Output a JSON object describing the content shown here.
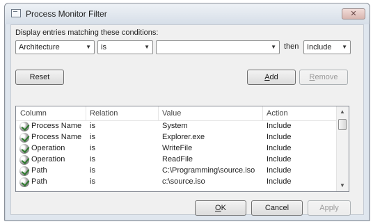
{
  "window": {
    "title": "Process Monitor Filter",
    "close_label": "✕"
  },
  "conditions": {
    "prompt": "Display entries matching these conditions:",
    "column_select": "Architecture",
    "relation_select": "is",
    "value_input": "",
    "then_label": "then",
    "action_select": "Include"
  },
  "buttons": {
    "reset": "Reset",
    "add": "Add",
    "remove": "Remove",
    "ok": "OK",
    "cancel": "Cancel",
    "apply": "Apply"
  },
  "list": {
    "headers": [
      "Column",
      "Relation",
      "Value",
      "Action"
    ],
    "rows": [
      {
        "column": "Process Name",
        "relation": "is",
        "value": "System",
        "action": "Include"
      },
      {
        "column": "Process Name",
        "relation": "is",
        "value": "Explorer.exe",
        "action": "Include"
      },
      {
        "column": "Operation",
        "relation": "is",
        "value": "WriteFile",
        "action": "Include"
      },
      {
        "column": "Operation",
        "relation": "is",
        "value": "ReadFile",
        "action": "Include"
      },
      {
        "column": "Path",
        "relation": "is",
        "value": "C:\\Programming\\source.iso",
        "action": "Include"
      },
      {
        "column": "Path",
        "relation": "is",
        "value": "c:\\source.iso",
        "action": "Include"
      }
    ]
  },
  "icons": {
    "row": "checkmark-icon",
    "dropdown": "chevron-down-icon",
    "scroll_up": "scroll-up-icon",
    "scroll_down": "scroll-down-icon"
  }
}
